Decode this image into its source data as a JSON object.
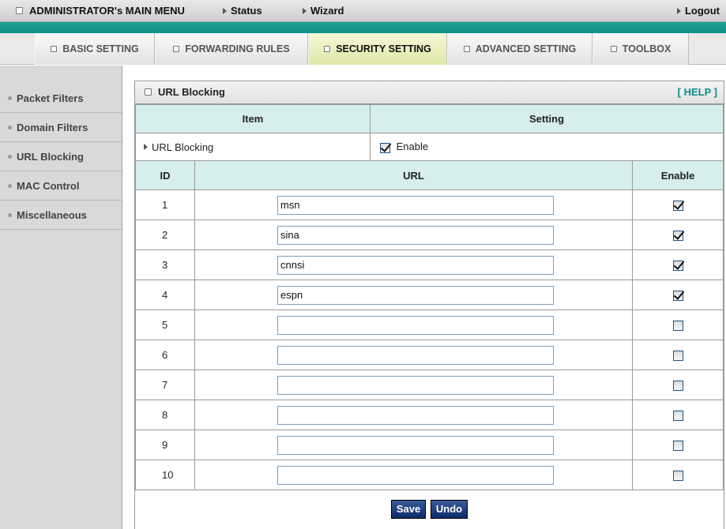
{
  "topbar": {
    "main_menu": "ADMINISTRATOR's MAIN MENU",
    "status": "Status",
    "wizard": "Wizard",
    "logout": "Logout"
  },
  "tabs": [
    {
      "label": "BASIC SETTING",
      "active": false
    },
    {
      "label": "FORWARDING RULES",
      "active": false
    },
    {
      "label": "SECURITY SETTING",
      "active": true
    },
    {
      "label": "ADVANCED SETTING",
      "active": false
    },
    {
      "label": "TOOLBOX",
      "active": false
    }
  ],
  "sidebar": {
    "items": [
      {
        "label": "Packet Filters"
      },
      {
        "label": "Domain Filters"
      },
      {
        "label": "URL Blocking"
      },
      {
        "label": "MAC Control"
      },
      {
        "label": "Miscellaneous"
      }
    ]
  },
  "panel": {
    "title": "URL Blocking",
    "help": "[ HELP ]",
    "col_item": "Item",
    "col_setting": "Setting",
    "url_blocking_label": "URL Blocking",
    "enable_label": "Enable",
    "enable_checked": true,
    "col_id": "ID",
    "col_url": "URL",
    "col_enable": "Enable",
    "rows": [
      {
        "id": "1",
        "url": "msn",
        "enabled": true
      },
      {
        "id": "2",
        "url": "sina",
        "enabled": true
      },
      {
        "id": "3",
        "url": "cnnsi",
        "enabled": true
      },
      {
        "id": "4",
        "url": "espn",
        "enabled": true
      },
      {
        "id": "5",
        "url": "",
        "enabled": false
      },
      {
        "id": "6",
        "url": "",
        "enabled": false
      },
      {
        "id": "7",
        "url": "",
        "enabled": false
      },
      {
        "id": "8",
        "url": "",
        "enabled": false
      },
      {
        "id": "9",
        "url": "",
        "enabled": false
      },
      {
        "id": "10",
        "url": "",
        "enabled": false
      }
    ],
    "save_label": "Save",
    "undo_label": "Undo"
  }
}
